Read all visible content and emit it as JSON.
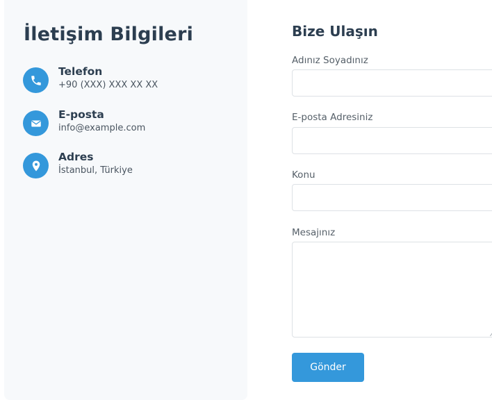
{
  "info": {
    "title": "İletişim Bilgileri",
    "items": [
      {
        "icon": "phone-icon",
        "label": "Telefon",
        "value": "+90 (XXX) XXX XX XX"
      },
      {
        "icon": "envelope-icon",
        "label": "E-posta",
        "value": "info@example.com"
      },
      {
        "icon": "location-pin-icon",
        "label": "Adres",
        "value": "İstanbul, Türkiye"
      }
    ]
  },
  "form": {
    "title": "Bize Ulaşın",
    "fields": [
      {
        "label": "Adınız Soyadınız",
        "value": ""
      },
      {
        "label": "E-posta Adresiniz",
        "value": ""
      },
      {
        "label": "Konu",
        "value": ""
      },
      {
        "label": "Mesajınız",
        "value": ""
      }
    ],
    "submit_label": "Gönder"
  },
  "colors": {
    "accent": "#3498db",
    "heading": "#2c3e50",
    "panel_background": "#f7f9fb"
  }
}
